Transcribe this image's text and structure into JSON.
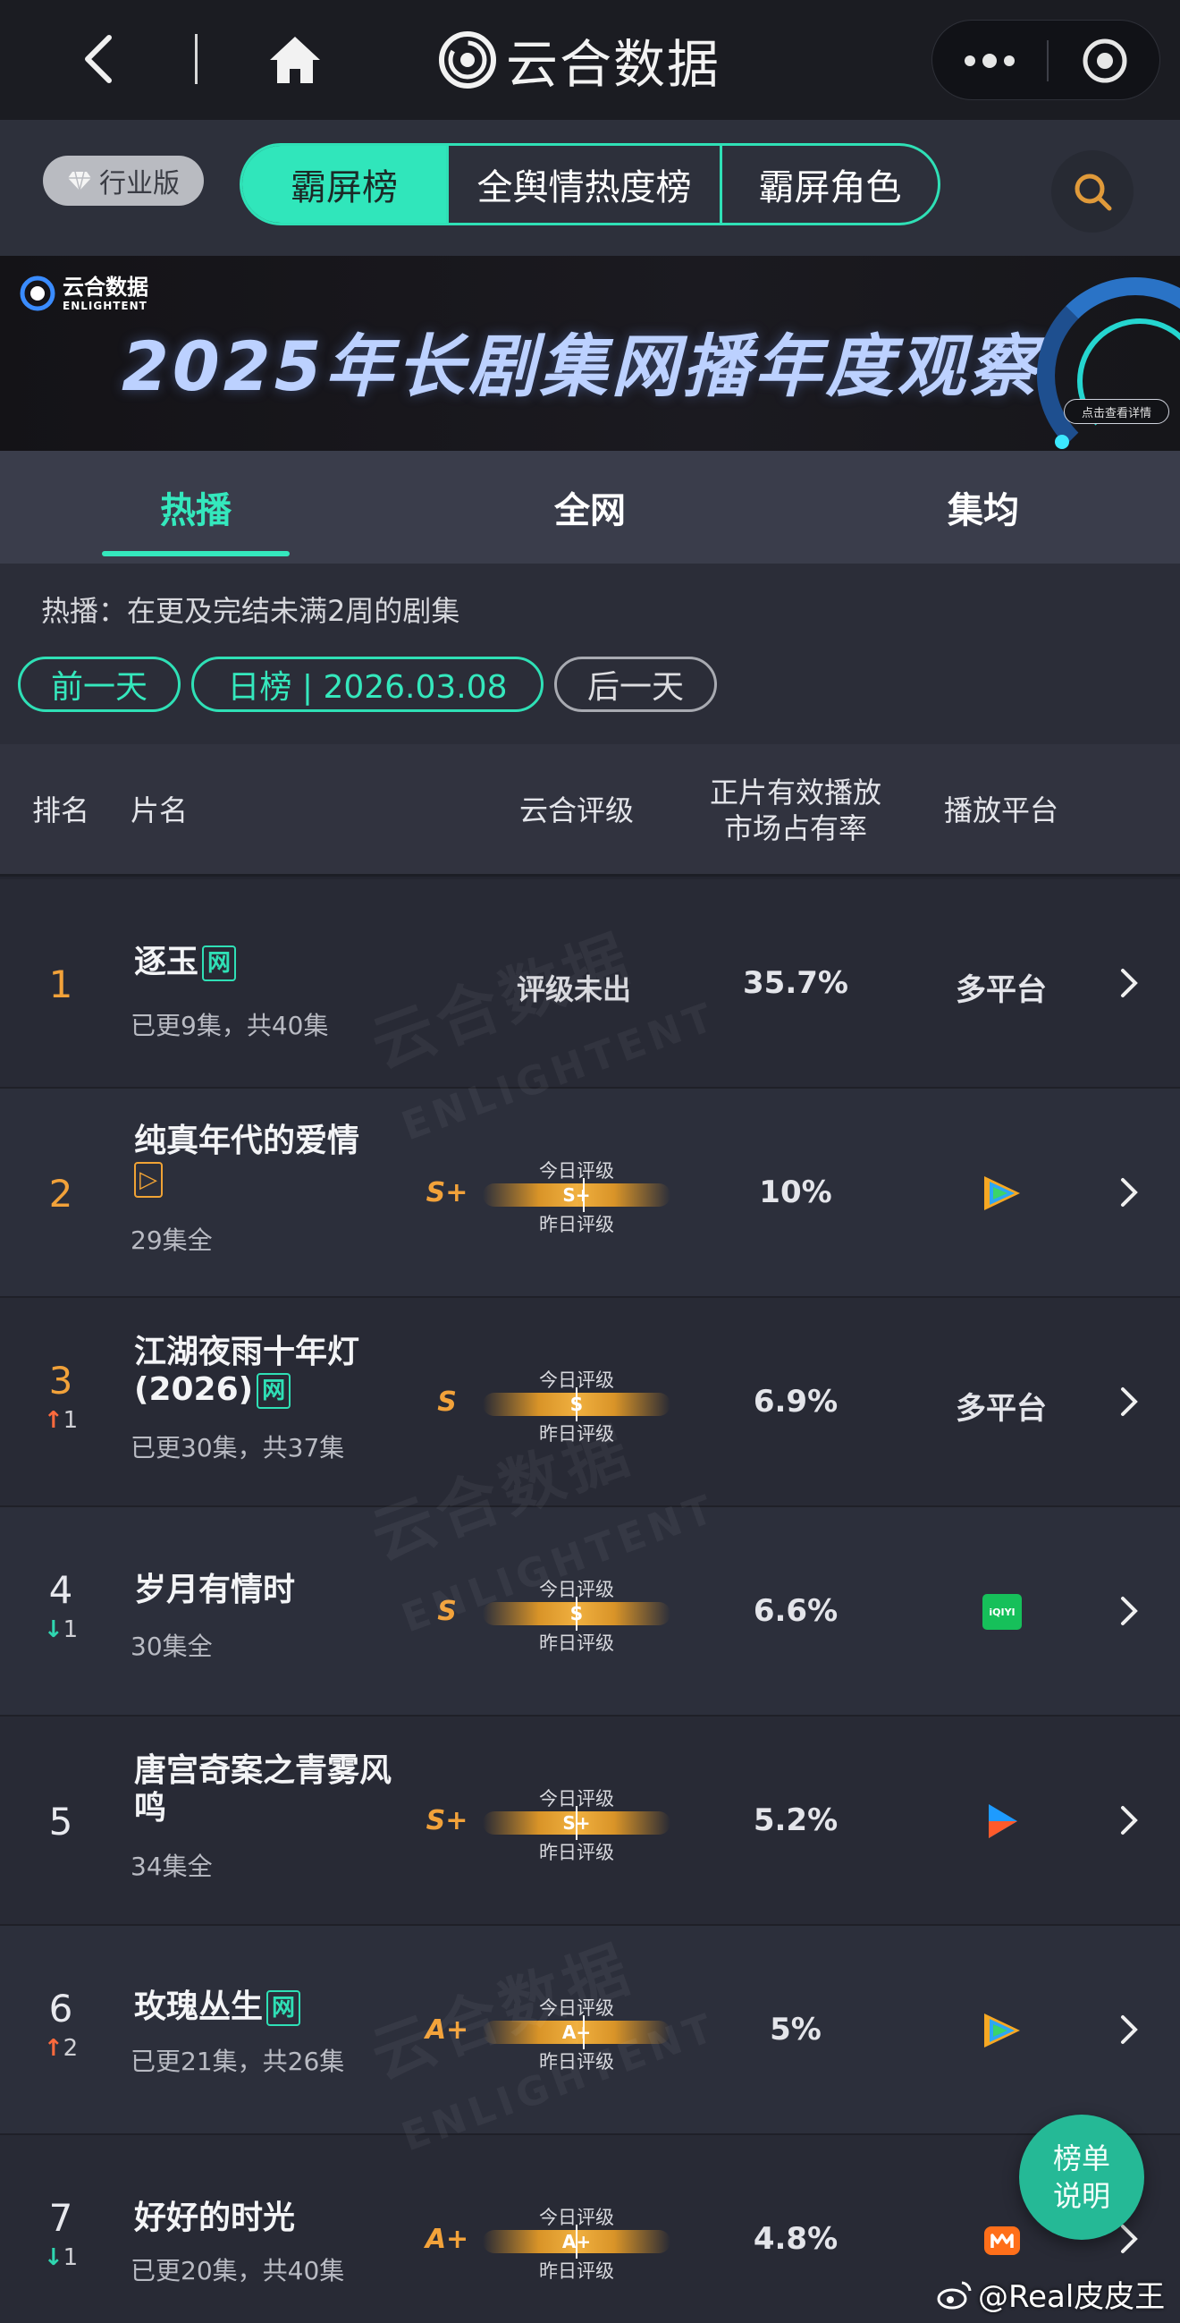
{
  "header": {
    "title": "云合数据"
  },
  "tabbar": {
    "edition_label": "行业版",
    "tabs": [
      {
        "label": "霸屏榜",
        "active": true
      },
      {
        "label": "全舆情热度榜",
        "active": false
      },
      {
        "label": "霸屏角色",
        "active": false
      }
    ]
  },
  "banner": {
    "logo_cn": "云合数据",
    "logo_en": "ENLIGHTENT",
    "title": "2025年长剧集网播年度观察",
    "button": "点击查看详情"
  },
  "subtabs": [
    {
      "label": "热播",
      "active": true
    },
    {
      "label": "全网",
      "active": false
    },
    {
      "label": "集均",
      "active": false
    }
  ],
  "note": "热播：在更及完结未满2周的剧集",
  "date_nav": {
    "prev": "前一天",
    "current": "日榜 | 2026.03.08",
    "next": "后一天"
  },
  "table": {
    "headers": {
      "rank": "排名",
      "name": "片名",
      "rating": "云合评级",
      "share_line1": "正片有效播放",
      "share_line2": "市场占有率",
      "platform": "播放平台"
    },
    "today_label": "今日评级",
    "yesterday_label": "昨日评级",
    "rows": [
      {
        "rank": "1",
        "title": "逐玉",
        "tag": "网",
        "sub": "已更9集，共40集",
        "rating_text": "评级未出",
        "share": "35.7%",
        "platform_text": "多平台"
      },
      {
        "rank": "2",
        "title": "纯真年代的爱情",
        "tag": "▷",
        "sub": "29集全",
        "grade": "S+",
        "today": "S+",
        "share": "10%",
        "platform_icon": "tencent-video-icon"
      },
      {
        "rank": "3",
        "trend": "up",
        "change": "1",
        "title": "江湖夜雨十年灯(2026)",
        "tag": "网",
        "sub": "已更30集，共37集",
        "grade": "S",
        "today": "S",
        "share": "6.9%",
        "platform_text": "多平台"
      },
      {
        "rank": "4",
        "trend": "down",
        "change": "1",
        "title": "岁月有情时",
        "sub": "30集全",
        "grade": "S",
        "today": "S",
        "share": "6.6%",
        "platform_icon": "iqiyi-icon",
        "platform_icon_text": "iQIYI"
      },
      {
        "rank": "5",
        "title": "唐宫奇案之青雾风鸣",
        "sub": "34集全",
        "grade": "S+",
        "today": "S+",
        "share": "5.2%",
        "platform_icon": "youku-icon"
      },
      {
        "rank": "6",
        "trend": "up",
        "change": "2",
        "title": "玫瑰丛生",
        "tag": "网",
        "sub": "已更21集，共26集",
        "grade": "A+",
        "today": "A+",
        "share": "5%",
        "platform_icon": "tencent-video-icon"
      },
      {
        "rank": "7",
        "trend": "down",
        "change": "1",
        "title": "好好的时光",
        "sub": "已更20集，共40集",
        "grade": "A+",
        "today": "A+",
        "share": "4.8%",
        "platform_icon": "mango-tv-icon"
      }
    ]
  },
  "fab": {
    "line1": "榜单",
    "line2": "说明"
  },
  "watermark": {
    "cn": "云合数据",
    "en": "ENLIGHTENT",
    "credit": "@Real皮皮王"
  },
  "colors": {
    "accent": "#30e6bb",
    "rank_top": "#f2a23a",
    "trend_up": "#ff6a3d",
    "trend_down": "#2fd6b0"
  }
}
